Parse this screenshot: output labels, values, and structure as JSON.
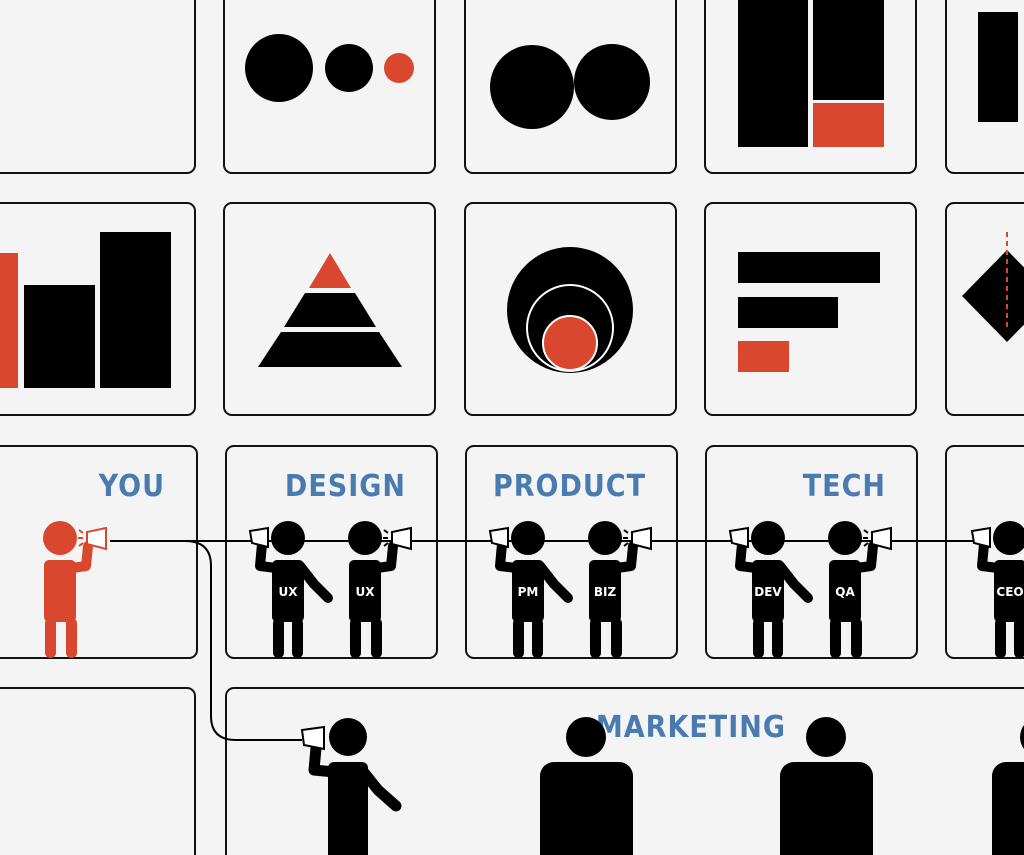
{
  "colors": {
    "accent": "#d9472f",
    "ink": "#000000",
    "label": "#4a7bb0",
    "background": "#f4f4f4"
  },
  "teams": [
    {
      "name": "YOU"
    },
    {
      "name": "DESIGN",
      "roles": [
        "UX",
        "UX"
      ]
    },
    {
      "name": "PRODUCT",
      "roles": [
        "PM",
        "BIZ"
      ]
    },
    {
      "name": "TECH",
      "roles": [
        "DEV",
        "QA"
      ]
    },
    {
      "roles": [
        "CEO"
      ]
    },
    {
      "name": "MARKETING"
    }
  ],
  "icons": [
    "circles-icon",
    "venn-icon",
    "stacked-bar-icon",
    "bar-chart-icon",
    "pyramid-icon",
    "nested-circles-icon",
    "horizontal-bar-icon",
    "diamond-icon"
  ]
}
